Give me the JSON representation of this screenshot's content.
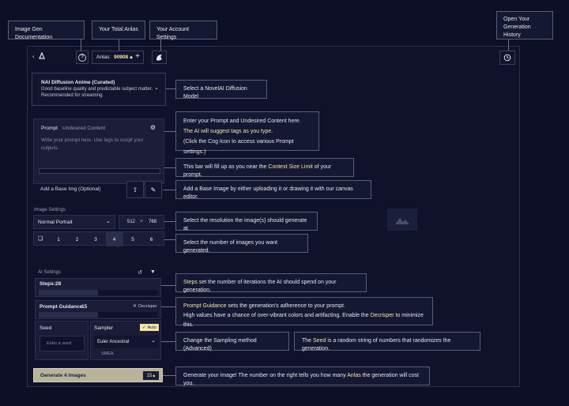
{
  "top_callouts": {
    "docs": "Image Gen Documentation",
    "anlas": "Your Total Anlas",
    "settings": "Your Account Settings",
    "history_line1": "Open Your",
    "history_line2": "Generation History"
  },
  "topbar": {
    "anlas_label": "Anlas:",
    "anlas_value": "90908",
    "help_glyph": "?",
    "plus_glyph": "+"
  },
  "model": {
    "name": "NAI Diffusion Anime (Curated)",
    "desc1": "Good baseline quality and predictable subject matter.",
    "desc2": "Recommended for streaming."
  },
  "prompt": {
    "tab_prompt": "Prompt",
    "tab_undesired": "Undesired Content",
    "placeholder1": "Write your prompt here. Use tags to sculpt your",
    "placeholder2": "outputs."
  },
  "base_img": {
    "label": "Add a Base Img (Optional)"
  },
  "image_settings": {
    "header": "Image Settings",
    "resolution": "Normal Portrait",
    "width": "512",
    "times": "×",
    "height": "768",
    "counts": [
      "1",
      "2",
      "3",
      "4",
      "5",
      "6"
    ],
    "selected_count": "4"
  },
  "ai_settings": {
    "header": "AI Settings",
    "steps_label": "Steps:",
    "steps_value": "28",
    "steps_fill": 0.5,
    "guidance_label": "Prompt Guidance:",
    "guidance_value": "15",
    "guidance_fill": 0.5,
    "decrisper": "Decrisper",
    "seed_label": "Seed",
    "seed_placeholder": "Enter a seed",
    "sampler_label": "Sampler",
    "auto_label": "Auto",
    "sampler_value": "Euler Ancestral",
    "smea": "SMEA"
  },
  "generate": {
    "label": "Generate 4 Images",
    "cost": "15"
  },
  "callouts": {
    "model": "Select a NovelAI Diffusion Model",
    "prompt1": "Enter your Prompt and Undesired Content here.",
    "prompt2": "The AI will suggest tags as you type.",
    "prompt3": "(Click the Cog Icon to access various Prompt settings.)",
    "bar_a": "This bar will fill up as you near the ",
    "bar_hl": "Context Size Limit",
    "bar_b": " of your prompt.",
    "base": "Add a Base Image by either uploading it or drawing it with our canvas editor.",
    "resolution": "Select the resolution the image(s) should generate at.",
    "number": "Select the number of images you want generated.",
    "steps_hl": "Steps",
    "steps_b": " set the number of iterations the AI should spend on your generation.",
    "guid_hl": "Prompt Guidance",
    "guid_b": " sets the generation's adherence to your prompt.",
    "guid2_a": "High values have a chance of over-vibrant colors and artifacting. Enable the ",
    "guid2_hl": "Decrisper",
    "guid2_b": " to minimize this.",
    "sampling": "Change the Sampling method (Advanced)",
    "seed_a": "The ",
    "seed_hl": "Seed",
    "seed_b": " is a random string of numbers that randomizes the generation.",
    "gen_a": "Generate your image! The number on the right tells you how many ",
    "gen_hl": "Anlas",
    "gen_b": " the generation will cost you."
  },
  "colors": {
    "background": "#0d0f26",
    "highlight": "#f5e6a6",
    "generate_button": "#b9b39a"
  }
}
